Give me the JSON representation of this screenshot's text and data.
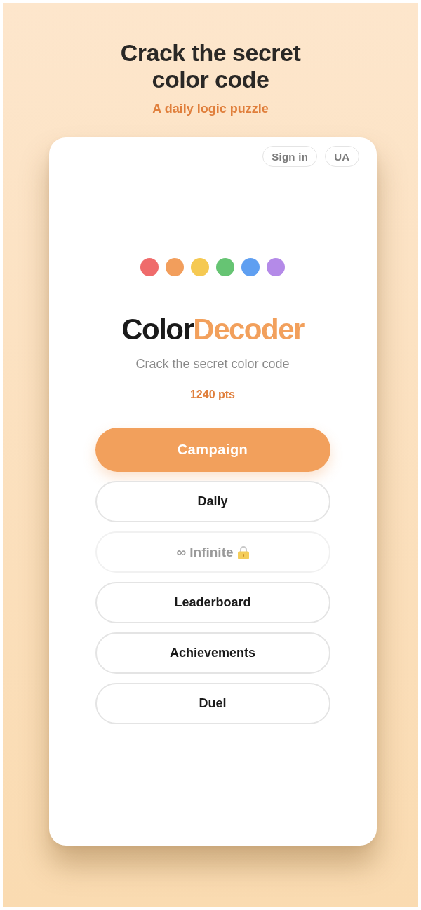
{
  "header": {
    "title": "Crack the secret color code",
    "subtitle": "A daily logic puzzle"
  },
  "top_buttons": [
    {
      "label": "Sign in"
    },
    {
      "label": "UA"
    }
  ],
  "color_dots": [
    {
      "color": "#ef6b6b"
    },
    {
      "color": "#f29e5c"
    },
    {
      "color": "#f5c952"
    },
    {
      "color": "#66c473"
    },
    {
      "color": "#5f9ff1"
    },
    {
      "color": "#b48ae8"
    }
  ],
  "logo": [
    {
      "text": "Color",
      "kind": "plain"
    },
    {
      "text": "Decoder",
      "kind": "accent"
    }
  ],
  "tagline": "Crack the secret color code",
  "points": "1240 pts",
  "menu": [
    {
      "label": "Campaign",
      "kind": "primary",
      "disabled": false,
      "locked": false
    },
    {
      "label": "Daily",
      "kind": "secondary",
      "disabled": false,
      "locked": false
    },
    {
      "label": "∞ Infinite",
      "kind": "secondary",
      "disabled": true,
      "locked": true
    },
    {
      "label": "Leaderboard",
      "kind": "secondary",
      "disabled": false,
      "locked": false
    },
    {
      "label": "Achievements",
      "kind": "secondary",
      "disabled": false,
      "locked": false
    },
    {
      "label": "Duel",
      "kind": "secondary",
      "disabled": false,
      "locked": false
    }
  ]
}
